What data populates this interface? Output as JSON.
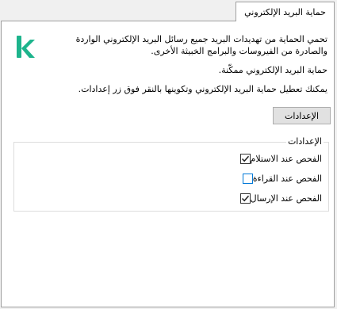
{
  "tab": {
    "label": "حماية البريد الإلكتروني"
  },
  "logo": {
    "letter": "k",
    "color": "#1db48c"
  },
  "description": "تحمي الحماية من تهديدات البريد جميع رسائل البريد الإلكتروني الواردة والصادرة من الفيروسات والبرامج الخبيثة الأخرى.",
  "status": "حماية البريد الإلكتروني ممكّنة.",
  "hint": "يمكنك تعطيل حماية البريد الإلكتروني وتكوينها بالنقر فوق زر إعدادات.",
  "settings_button": {
    "label": "الإعدادات"
  },
  "settings_group": {
    "title": "الإعدادات",
    "options": [
      {
        "label": "الفحص عند الاستلام",
        "checked": true
      },
      {
        "label": "الفحص عند القراءة",
        "checked": false
      },
      {
        "label": "الفحص عند الإرسال",
        "checked": true
      }
    ]
  }
}
